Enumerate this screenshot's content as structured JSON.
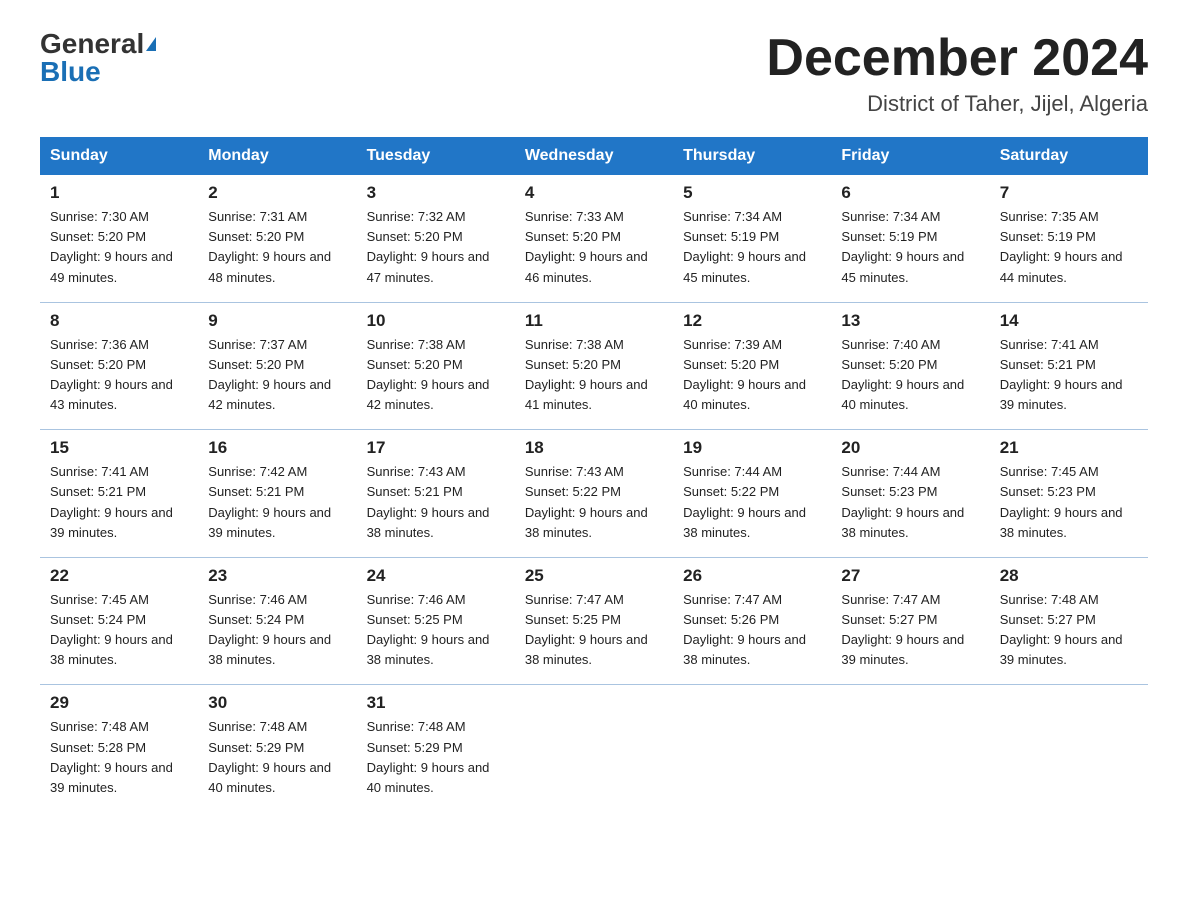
{
  "header": {
    "logo_general": "General",
    "logo_blue": "Blue",
    "month_title": "December 2024",
    "location": "District of Taher, Jijel, Algeria"
  },
  "days_of_week": [
    "Sunday",
    "Monday",
    "Tuesday",
    "Wednesday",
    "Thursday",
    "Friday",
    "Saturday"
  ],
  "weeks": [
    [
      {
        "day": "1",
        "sunrise": "7:30 AM",
        "sunset": "5:20 PM",
        "daylight": "9 hours and 49 minutes."
      },
      {
        "day": "2",
        "sunrise": "7:31 AM",
        "sunset": "5:20 PM",
        "daylight": "9 hours and 48 minutes."
      },
      {
        "day": "3",
        "sunrise": "7:32 AM",
        "sunset": "5:20 PM",
        "daylight": "9 hours and 47 minutes."
      },
      {
        "day": "4",
        "sunrise": "7:33 AM",
        "sunset": "5:20 PM",
        "daylight": "9 hours and 46 minutes."
      },
      {
        "day": "5",
        "sunrise": "7:34 AM",
        "sunset": "5:19 PM",
        "daylight": "9 hours and 45 minutes."
      },
      {
        "day": "6",
        "sunrise": "7:34 AM",
        "sunset": "5:19 PM",
        "daylight": "9 hours and 45 minutes."
      },
      {
        "day": "7",
        "sunrise": "7:35 AM",
        "sunset": "5:19 PM",
        "daylight": "9 hours and 44 minutes."
      }
    ],
    [
      {
        "day": "8",
        "sunrise": "7:36 AM",
        "sunset": "5:20 PM",
        "daylight": "9 hours and 43 minutes."
      },
      {
        "day": "9",
        "sunrise": "7:37 AM",
        "sunset": "5:20 PM",
        "daylight": "9 hours and 42 minutes."
      },
      {
        "day": "10",
        "sunrise": "7:38 AM",
        "sunset": "5:20 PM",
        "daylight": "9 hours and 42 minutes."
      },
      {
        "day": "11",
        "sunrise": "7:38 AM",
        "sunset": "5:20 PM",
        "daylight": "9 hours and 41 minutes."
      },
      {
        "day": "12",
        "sunrise": "7:39 AM",
        "sunset": "5:20 PM",
        "daylight": "9 hours and 40 minutes."
      },
      {
        "day": "13",
        "sunrise": "7:40 AM",
        "sunset": "5:20 PM",
        "daylight": "9 hours and 40 minutes."
      },
      {
        "day": "14",
        "sunrise": "7:41 AM",
        "sunset": "5:21 PM",
        "daylight": "9 hours and 39 minutes."
      }
    ],
    [
      {
        "day": "15",
        "sunrise": "7:41 AM",
        "sunset": "5:21 PM",
        "daylight": "9 hours and 39 minutes."
      },
      {
        "day": "16",
        "sunrise": "7:42 AM",
        "sunset": "5:21 PM",
        "daylight": "9 hours and 39 minutes."
      },
      {
        "day": "17",
        "sunrise": "7:43 AM",
        "sunset": "5:21 PM",
        "daylight": "9 hours and 38 minutes."
      },
      {
        "day": "18",
        "sunrise": "7:43 AM",
        "sunset": "5:22 PM",
        "daylight": "9 hours and 38 minutes."
      },
      {
        "day": "19",
        "sunrise": "7:44 AM",
        "sunset": "5:22 PM",
        "daylight": "9 hours and 38 minutes."
      },
      {
        "day": "20",
        "sunrise": "7:44 AM",
        "sunset": "5:23 PM",
        "daylight": "9 hours and 38 minutes."
      },
      {
        "day": "21",
        "sunrise": "7:45 AM",
        "sunset": "5:23 PM",
        "daylight": "9 hours and 38 minutes."
      }
    ],
    [
      {
        "day": "22",
        "sunrise": "7:45 AM",
        "sunset": "5:24 PM",
        "daylight": "9 hours and 38 minutes."
      },
      {
        "day": "23",
        "sunrise": "7:46 AM",
        "sunset": "5:24 PM",
        "daylight": "9 hours and 38 minutes."
      },
      {
        "day": "24",
        "sunrise": "7:46 AM",
        "sunset": "5:25 PM",
        "daylight": "9 hours and 38 minutes."
      },
      {
        "day": "25",
        "sunrise": "7:47 AM",
        "sunset": "5:25 PM",
        "daylight": "9 hours and 38 minutes."
      },
      {
        "day": "26",
        "sunrise": "7:47 AM",
        "sunset": "5:26 PM",
        "daylight": "9 hours and 38 minutes."
      },
      {
        "day": "27",
        "sunrise": "7:47 AM",
        "sunset": "5:27 PM",
        "daylight": "9 hours and 39 minutes."
      },
      {
        "day": "28",
        "sunrise": "7:48 AM",
        "sunset": "5:27 PM",
        "daylight": "9 hours and 39 minutes."
      }
    ],
    [
      {
        "day": "29",
        "sunrise": "7:48 AM",
        "sunset": "5:28 PM",
        "daylight": "9 hours and 39 minutes."
      },
      {
        "day": "30",
        "sunrise": "7:48 AM",
        "sunset": "5:29 PM",
        "daylight": "9 hours and 40 minutes."
      },
      {
        "day": "31",
        "sunrise": "7:48 AM",
        "sunset": "5:29 PM",
        "daylight": "9 hours and 40 minutes."
      },
      null,
      null,
      null,
      null
    ]
  ]
}
